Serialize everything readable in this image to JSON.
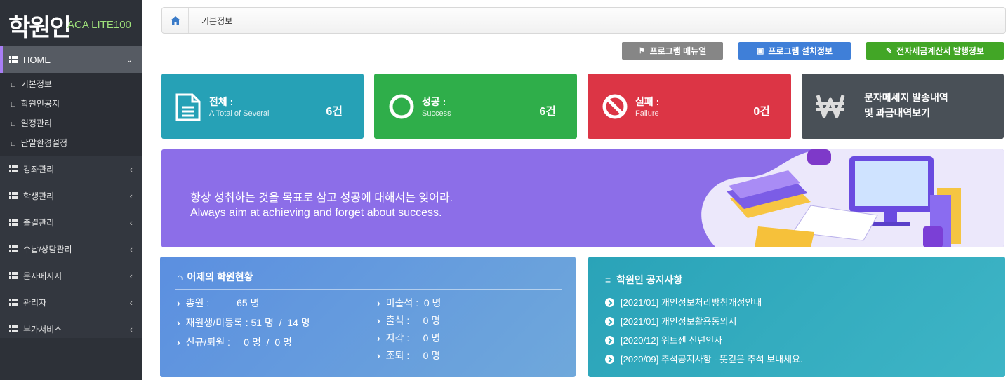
{
  "logo": {
    "mark": "학원인",
    "product": "ACA LITE100"
  },
  "sidebar": {
    "home_label": "HOME",
    "sub_items": [
      "기본정보",
      "학원인공지",
      "일정관리",
      "단말환경설정"
    ],
    "items": [
      "강좌관리",
      "학생관리",
      "출결관리",
      "수납/상담관리",
      "문자메시지",
      "관리자",
      "부가서비스"
    ]
  },
  "breadcrumb": {
    "current": "기본정보"
  },
  "buttons": {
    "manual": "프로그램 매뉴얼",
    "install": "프로그램 설치정보",
    "tax": "전자세금계산서 발행정보"
  },
  "cards": {
    "total": {
      "title": "전체 :",
      "subtitle": "A Total of Several",
      "count": "6건"
    },
    "success": {
      "title": "성공 :",
      "subtitle": "Success",
      "count": "6건"
    },
    "failure": {
      "title": "실패 :",
      "subtitle": "Failure",
      "count": "0건"
    },
    "sms": {
      "line1": "문자메세지 발송내역",
      "line2": "및 과금내역보기"
    }
  },
  "banner": {
    "line_ko": "항상 성취하는 것을 목표로 삼고 성공에 대해서는 잊어라.",
    "line_en": "Always aim at achieving and forget about success."
  },
  "status_panel": {
    "title": "어제의 학원현황",
    "left": [
      "총원 :          65 명",
      "재원생/미등록 : 51 명  /  14 명",
      "신규/퇴원 :     0 명  /  0 명"
    ],
    "right": [
      "미출석 :  0 명",
      "출석 :     0 명",
      "지각 :     0 명",
      "조퇴 :     0 명"
    ]
  },
  "notice_panel": {
    "title": "학원인 공지사항",
    "items": [
      "[2021/01]  개인정보처리방침개정안내",
      "[2021/01]  개인정보활용동의서",
      "[2020/12]  위트젠 신년인사",
      "[2020/09]  추석공지사항 - 뜻깊은 추석 보내세요."
    ]
  },
  "colors": {
    "sidebar": "#33373f",
    "accent": "#a87ef5",
    "card_total": "#26a1b6",
    "card_success": "#2fae4a",
    "card_failure": "#dc3545",
    "card_sms": "#495057",
    "banner": "#8c6ee8",
    "btn_manual": "#868686",
    "btn_install": "#3f7fd8",
    "btn_tax": "#42a626"
  }
}
